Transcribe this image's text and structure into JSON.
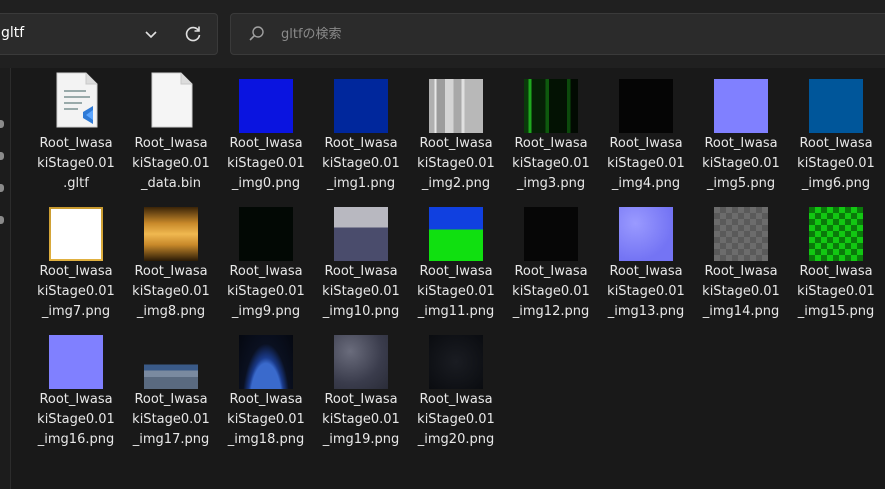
{
  "address_bar": {
    "path": "gltf"
  },
  "search": {
    "placeholder": "gltfの検索"
  },
  "files": [
    {
      "line1": "Root_Iwasa",
      "line2": "kiStage0.01",
      "line3": ".gltf",
      "thumb": "gltf-document-icon"
    },
    {
      "line1": "Root_Iwasa",
      "line2": "kiStage0.01",
      "line3": "_data.bin",
      "thumb": "blank-document-icon"
    },
    {
      "line1": "Root_Iwasa",
      "line2": "kiStage0.01",
      "line3": "_img0.png",
      "thumb": "solid",
      "fill": "#0a14e0"
    },
    {
      "line1": "Root_Iwasa",
      "line2": "kiStage0.01",
      "line3": "_img1.png",
      "thumb": "solid",
      "fill": "#00279c"
    },
    {
      "line1": "Root_Iwasa",
      "line2": "kiStage0.01",
      "line3": "_img2.png",
      "thumb": "glitch-gray"
    },
    {
      "line1": "Root_Iwasa",
      "line2": "kiStage0.01",
      "line3": "_img3.png",
      "thumb": "glitch-green"
    },
    {
      "line1": "Root_Iwasa",
      "line2": "kiStage0.01",
      "line3": "_img4.png",
      "thumb": "solid",
      "fill": "#050505"
    },
    {
      "line1": "Root_Iwasa",
      "line2": "kiStage0.01",
      "line3": "_img5.png",
      "thumb": "solid",
      "fill": "#8080ff"
    },
    {
      "line1": "Root_Iwasa",
      "line2": "kiStage0.01",
      "line3": "_img6.png",
      "thumb": "solid",
      "fill": "#00569a"
    },
    {
      "line1": "Root_Iwasa",
      "line2": "kiStage0.01",
      "line3": "_img7.png",
      "thumb": "white-gold-border"
    },
    {
      "line1": "Root_Iwasa",
      "line2": "kiStage0.01",
      "line3": "_img8.png",
      "thumb": "gold-gradient"
    },
    {
      "line1": "Root_Iwasa",
      "line2": "kiStage0.01",
      "line3": "_img9.png",
      "thumb": "solid",
      "fill": "#020804"
    },
    {
      "line1": "Root_Iwasa",
      "line2": "kiStage0.01",
      "line3": "_img10.png",
      "thumb": "gray-slate"
    },
    {
      "line1": "Root_Iwasa",
      "line2": "kiStage0.01",
      "line3": "_img11.png",
      "thumb": "blue-green"
    },
    {
      "line1": "Root_Iwasa",
      "line2": "kiStage0.01",
      "line3": "_img12.png",
      "thumb": "solid",
      "fill": "#060606"
    },
    {
      "line1": "Root_Iwasa",
      "line2": "kiStage0.01",
      "line3": "_img13.png",
      "thumb": "normal-map"
    },
    {
      "line1": "Root_Iwasa",
      "line2": "kiStage0.01",
      "line3": "_img14.png",
      "thumb": "checker-gray"
    },
    {
      "line1": "Root_Iwasa",
      "line2": "kiStage0.01",
      "line3": "_img15.png",
      "thumb": "checker-green"
    },
    {
      "line1": "Root_Iwasa",
      "line2": "kiStage0.01",
      "line3": "_img16.png",
      "thumb": "solid",
      "fill": "#8080ff"
    },
    {
      "line1": "Root_Iwasa",
      "line2": "kiStage0.01",
      "line3": "_img17.png",
      "thumb": "earth-horizon"
    },
    {
      "line1": "Root_Iwasa",
      "line2": "kiStage0.01",
      "line3": "_img18.png",
      "thumb": "earth-night"
    },
    {
      "line1": "Root_Iwasa",
      "line2": "kiStage0.01",
      "line3": "_img19.png",
      "thumb": "rock-texture"
    },
    {
      "line1": "Root_Iwasa",
      "line2": "kiStage0.01",
      "line3": "_img20.png",
      "thumb": "dark-texture"
    }
  ]
}
